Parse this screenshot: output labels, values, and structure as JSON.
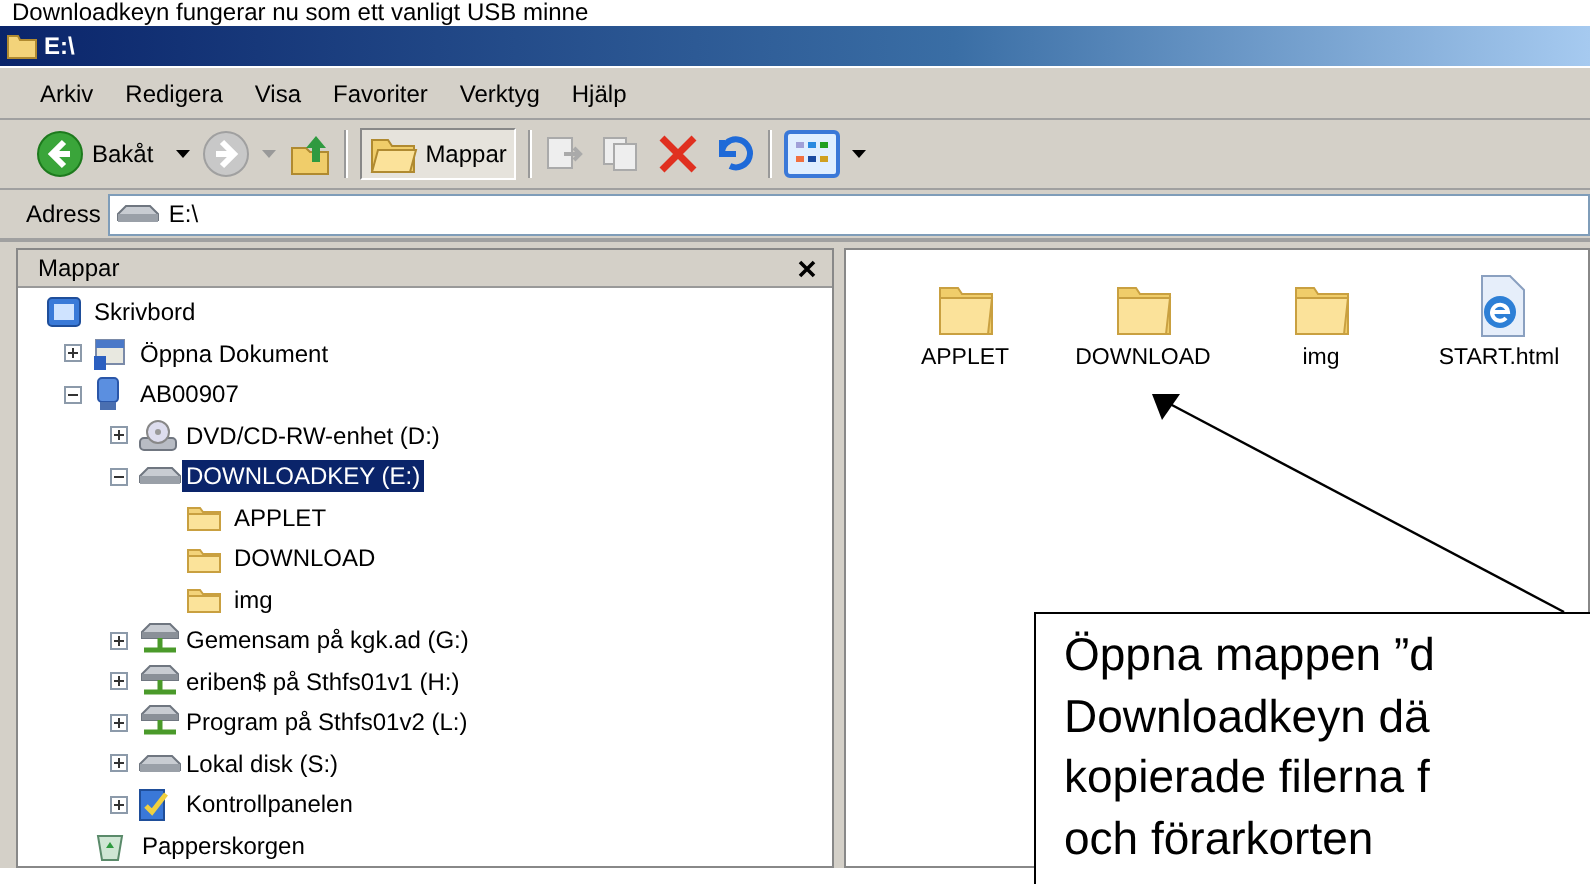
{
  "caption": "Downloadkeyn fungerar nu som ett vanligt USB minne",
  "window": {
    "title": "E:\\"
  },
  "menu": [
    "Arkiv",
    "Redigera",
    "Visa",
    "Favoriter",
    "Verktyg",
    "Hjälp"
  ],
  "toolbar": {
    "back": "Bakåt",
    "folders": {
      "label": "Mappar",
      "pressed": true
    }
  },
  "address": {
    "label": "Adress",
    "value": "E:\\"
  },
  "folder_pane": {
    "title": "Mappar",
    "tree": [
      {
        "label": "Skrivbord",
        "kind": "desktop",
        "selected": false,
        "children": [
          {
            "label": "Öppna Dokument",
            "kind": "documents",
            "expanded": false,
            "selected": false
          },
          {
            "label": "AB00907",
            "kind": "computer",
            "expanded": true,
            "selected": false,
            "children": [
              {
                "label": "DVD/CD-RW-enhet (D:)",
                "kind": "cdrom",
                "expanded": false,
                "selected": false
              },
              {
                "label": "DOWNLOADKEY (E:)",
                "kind": "drive",
                "expanded": true,
                "selected": true,
                "children": [
                  {
                    "label": "APPLET",
                    "kind": "folder",
                    "selected": false
                  },
                  {
                    "label": "DOWNLOAD",
                    "kind": "folder",
                    "selected": false
                  },
                  {
                    "label": "img",
                    "kind": "folder",
                    "selected": false
                  }
                ]
              },
              {
                "label": "Gemensam på kgk.ad (G:)",
                "kind": "network",
                "expanded": false,
                "selected": false
              },
              {
                "label": "eriben$ på Sthfs01v1 (H:)",
                "kind": "network",
                "expanded": false,
                "selected": false
              },
              {
                "label": "Program på Sthfs01v2 (L:)",
                "kind": "network",
                "expanded": false,
                "selected": false
              },
              {
                "label": "Lokal disk (S:)",
                "kind": "drive",
                "expanded": false,
                "selected": false
              },
              {
                "label": "Kontrollpanelen",
                "kind": "controlpanel",
                "expanded": false,
                "selected": false
              }
            ]
          },
          {
            "label": "Papperskorgen",
            "kind": "recycle",
            "selected": false
          }
        ]
      }
    ]
  },
  "files": [
    {
      "name": "APPLET",
      "kind": "folder"
    },
    {
      "name": "DOWNLOAD",
      "kind": "folder"
    },
    {
      "name": "img",
      "kind": "folder"
    },
    {
      "name": "START.html",
      "kind": "html"
    }
  ],
  "callout": {
    "lines": [
      "Öppna mappen ”d",
      "Downloadkeyn dä",
      "kopierade filerna f",
      "och förarkorten"
    ]
  }
}
